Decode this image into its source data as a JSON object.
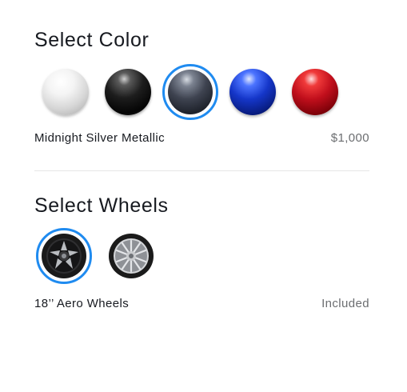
{
  "color_section": {
    "title": "Select Color",
    "swatches": [
      {
        "name": "White",
        "icon": "white-paint-swatch",
        "hex": "#e8e8e8",
        "selected": false
      },
      {
        "name": "Black",
        "icon": "black-paint-swatch",
        "hex": "#111111",
        "selected": false
      },
      {
        "name": "Midnight Silver Metallic",
        "icon": "midnight-silver-paint-swatch",
        "hex": "#3e4350",
        "selected": true
      },
      {
        "name": "Blue",
        "icon": "blue-paint-swatch",
        "hex": "#1536c9",
        "selected": false
      },
      {
        "name": "Red",
        "icon": "red-paint-swatch",
        "hex": "#c10f1c",
        "selected": false
      }
    ],
    "selected_name": "Midnight Silver Metallic",
    "selected_price": "$1,000"
  },
  "wheels_section": {
    "title": "Select Wheels",
    "options": [
      {
        "icon": "aero-wheel-icon",
        "selected": true
      },
      {
        "icon": "sport-wheel-icon",
        "selected": false
      }
    ],
    "selected_name": "18’’ Aero Wheels",
    "selected_price": "Included"
  },
  "colors": {
    "accent": "#1f8bf0",
    "text": "#171a20",
    "muted": "#6b6d70",
    "divider": "#e6e6e6"
  }
}
